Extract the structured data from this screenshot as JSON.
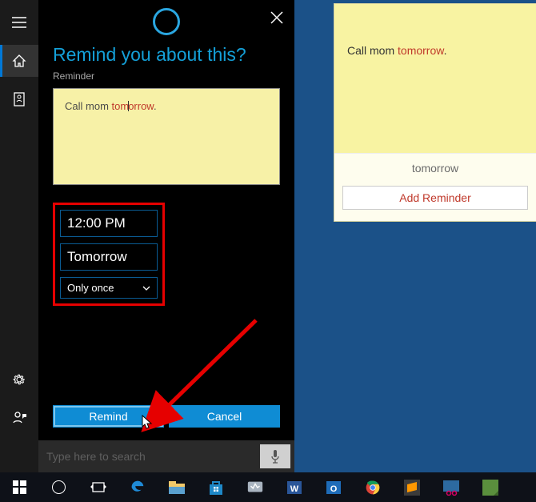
{
  "cortana": {
    "title": "Remind you about this?",
    "section_label": "Reminder",
    "note_text": "Call mom ",
    "note_err": "tomorrow",
    "note_tail": ".",
    "time": "12:00 PM",
    "day": "Tomorrow",
    "recurrence": "Only once",
    "btn_primary": "Remind",
    "btn_secondary": "Cancel",
    "search_placeholder": "Type here to search"
  },
  "sticky": {
    "text1": "Call mom ",
    "err": "tomorrow",
    "tail": ".",
    "meta": "tomorrow",
    "action": "Add Reminder"
  }
}
